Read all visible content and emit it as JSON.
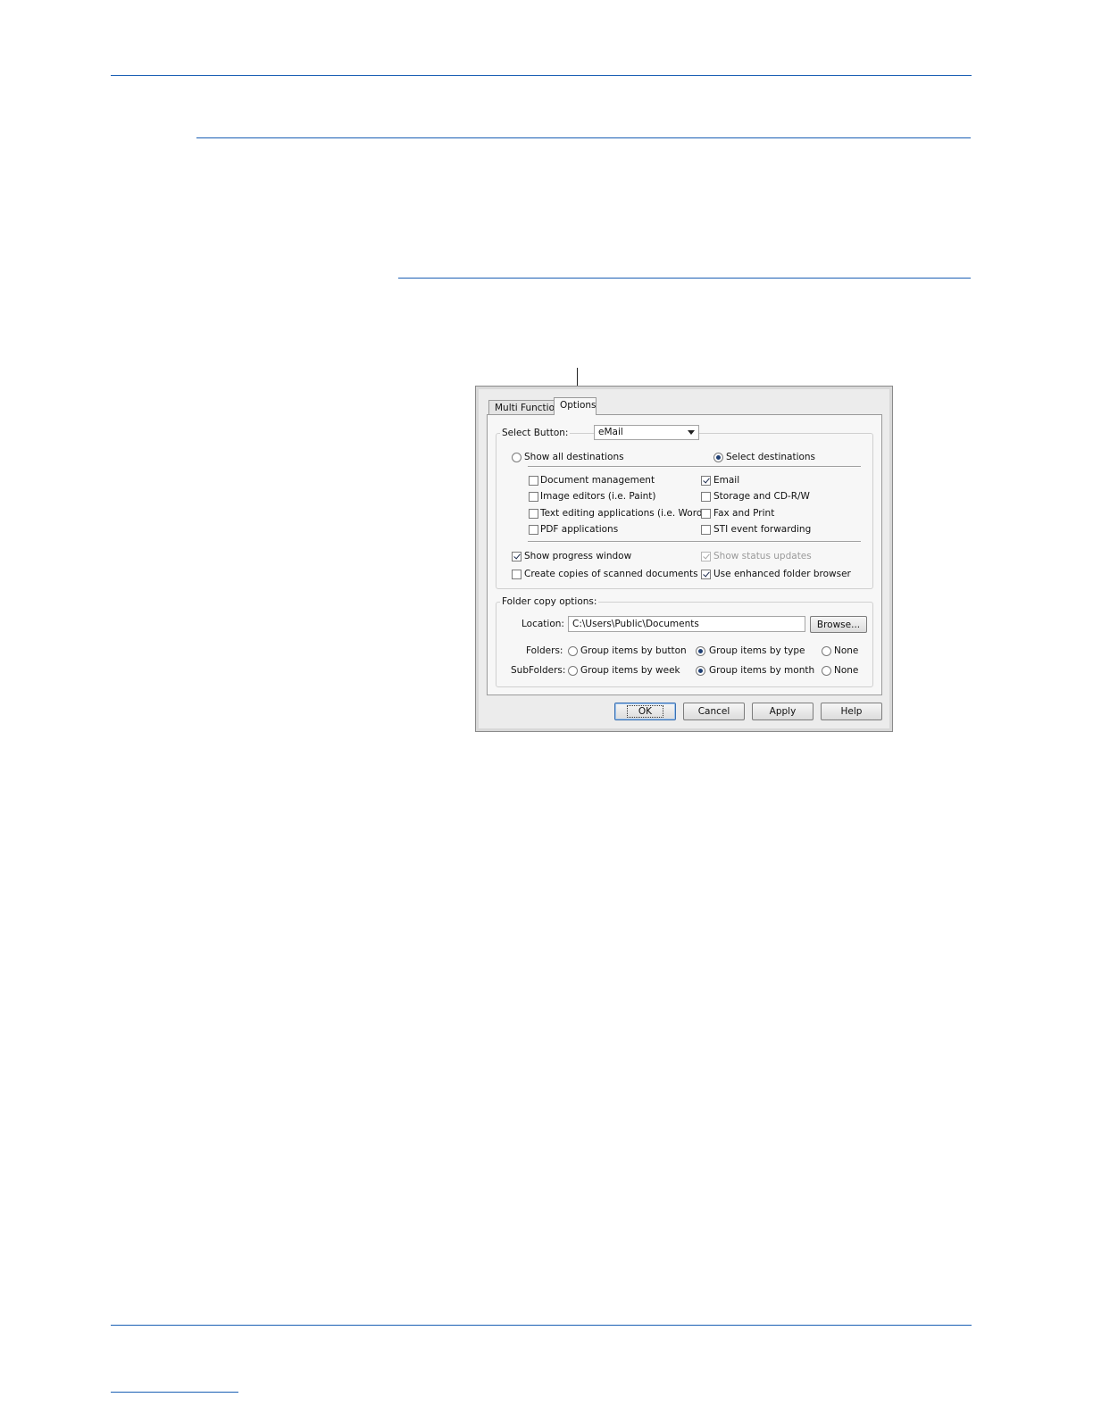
{
  "dialog": {
    "tabs": [
      {
        "label": "Multi Function",
        "active": false
      },
      {
        "label": "Options",
        "active": true
      }
    ],
    "select_button": {
      "label": "Select Button:",
      "value": "eMail"
    },
    "show_all_destinations": {
      "label": "Show all destinations",
      "selected": false
    },
    "select_destinations": {
      "label": "Select destinations",
      "selected": true
    },
    "destinations_left": [
      {
        "label": "Document management",
        "checked": false
      },
      {
        "label": "Image editors (i.e. Paint)",
        "checked": false
      },
      {
        "label": "Text editing applications (i.e. Word)",
        "checked": false
      },
      {
        "label": "PDF applications",
        "checked": false
      }
    ],
    "destinations_right": [
      {
        "label": "Email",
        "checked": true
      },
      {
        "label": "Storage and CD-R/W",
        "checked": false
      },
      {
        "label": "Fax and Print",
        "checked": false
      },
      {
        "label": "STI event forwarding",
        "checked": false
      }
    ],
    "show_progress_window": {
      "label": "Show progress window",
      "checked": true
    },
    "create_copies": {
      "label": "Create copies of scanned documents",
      "checked": false
    },
    "show_status_updates": {
      "label": "Show status updates",
      "checked": true,
      "disabled": true
    },
    "use_enhanced_browser": {
      "label": "Use enhanced folder browser",
      "checked": true
    },
    "folder_copy": {
      "legend": "Folder copy options:",
      "location_label": "Location:",
      "location_value": "C:\\Users\\Public\\Documents",
      "browse_label": "Browse...",
      "folders_label": "Folders:",
      "folders_options": [
        {
          "label": "Group items by button",
          "selected": false
        },
        {
          "label": "Group items by type",
          "selected": true
        },
        {
          "label": "None",
          "selected": false
        }
      ],
      "subfolders_label": "SubFolders:",
      "subfolders_options": [
        {
          "label": "Group items by week",
          "selected": false
        },
        {
          "label": "Group items by month",
          "selected": true
        },
        {
          "label": "None",
          "selected": false
        }
      ]
    },
    "buttons": {
      "ok": "OK",
      "cancel": "Cancel",
      "apply": "Apply",
      "help": "Help"
    }
  }
}
